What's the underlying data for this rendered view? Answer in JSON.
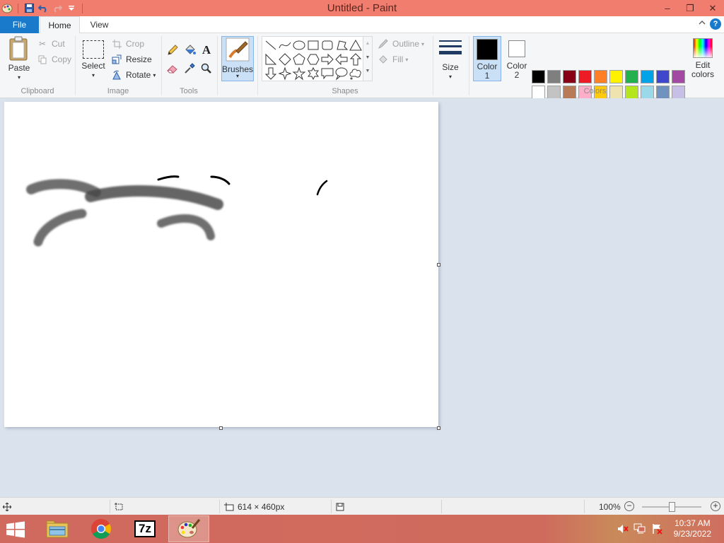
{
  "window": {
    "title": "Untitled - Paint",
    "controls": {
      "minimize": "–",
      "restore": "❐",
      "close": "✕"
    }
  },
  "ribbon": {
    "tabs": {
      "file": "File",
      "home": "Home",
      "view": "View"
    },
    "help": "?",
    "clipboard": {
      "paste": "Paste",
      "cut": "Cut",
      "copy": "Copy",
      "label": "Clipboard"
    },
    "image": {
      "select": "Select",
      "crop": "Crop",
      "resize": "Resize",
      "rotate": "Rotate",
      "label": "Image"
    },
    "tools": {
      "label": "Tools"
    },
    "brushes": {
      "label": "Brushes"
    },
    "shapes": {
      "outline": "Outline",
      "fill": "Fill",
      "label": "Shapes"
    },
    "size": {
      "label": "Size"
    },
    "colors": {
      "color1_line1": "Color",
      "color1_line2": "1",
      "color2_line1": "Color",
      "color2_line2": "2",
      "color1": "#000000",
      "color2": "#ffffff",
      "edit_line1": "Edit",
      "edit_line2": "colors",
      "label": "Colors",
      "palette_row1": [
        "#000000",
        "#7f7f7f",
        "#880015",
        "#ed1c24",
        "#ff7f27",
        "#fff200",
        "#22b14c",
        "#00a2e8",
        "#3f48cc",
        "#a349a4"
      ],
      "palette_row2": [
        "#ffffff",
        "#c3c3c3",
        "#b97a57",
        "#ffaec9",
        "#ffc90e",
        "#efe4b0",
        "#b5e61d",
        "#99d9ea",
        "#7092be",
        "#c8bfe7"
      ],
      "palette_row3": [
        "#ffffff",
        "#ffffff",
        "#ffffff",
        "#ffffff",
        "#ffffff",
        "#ffffff",
        "#ffffff",
        "#ffffff",
        "#ffffff",
        "#ffffff"
      ]
    }
  },
  "status": {
    "canvas_size": "614 × 460px",
    "zoom": "100%"
  },
  "taskbar": {
    "apps": [
      {
        "name": "File Explorer",
        "icon": "folder-icon"
      },
      {
        "name": "Google Chrome",
        "icon": "chrome-icon"
      },
      {
        "name": "7-Zip",
        "icon": "7zip-icon",
        "text": "7z"
      },
      {
        "name": "Paint",
        "icon": "paint-icon"
      }
    ],
    "time": "10:37 AM",
    "date": "9/23/2022"
  }
}
